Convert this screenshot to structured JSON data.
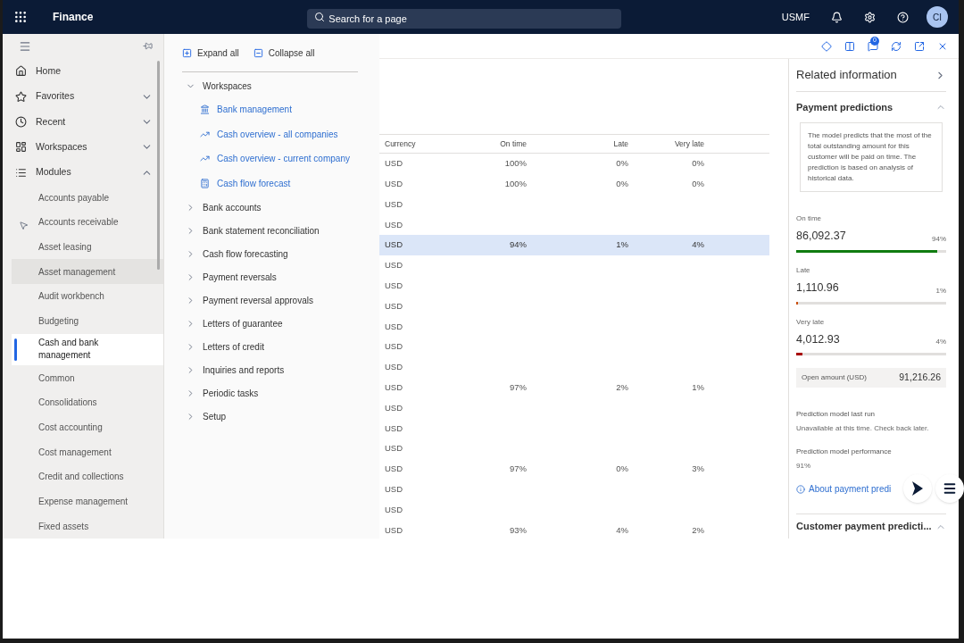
{
  "top_bar": {
    "app_name": "Finance",
    "search": {
      "placeholder": "Search for a page"
    },
    "company": "USMF",
    "avatar": "CI"
  },
  "nav": {
    "items": [
      {
        "label": "Home",
        "kind": "home"
      },
      {
        "label": "Favorites",
        "kind": "star",
        "expanded": false
      },
      {
        "label": "Recent",
        "kind": "clock",
        "expanded": false
      },
      {
        "label": "Workspaces",
        "kind": "workspace",
        "expanded": false
      },
      {
        "label": "Modules",
        "kind": "list",
        "expanded": true
      }
    ],
    "modules": [
      {
        "label": "Accounts payable",
        "selected": false,
        "hovered": false
      },
      {
        "label": "Accounts receivable",
        "selected": false,
        "hovered": false
      },
      {
        "label": "Asset leasing",
        "selected": false,
        "hovered": false
      },
      {
        "label": "Asset management",
        "selected": false,
        "hovered": true
      },
      {
        "label": "Audit workbench",
        "selected": false,
        "hovered": false
      },
      {
        "label": "Budgeting",
        "selected": false,
        "hovered": false
      },
      {
        "label": "Cash and bank management",
        "selected": true,
        "hovered": false
      },
      {
        "label": "Common",
        "selected": false,
        "hovered": false
      },
      {
        "label": "Consolidations",
        "selected": false,
        "hovered": false
      },
      {
        "label": "Cost accounting",
        "selected": false,
        "hovered": false
      },
      {
        "label": "Cost management",
        "selected": false,
        "hovered": false
      },
      {
        "label": "Credit and collections",
        "selected": false,
        "hovered": false
      },
      {
        "label": "Expense management",
        "selected": false,
        "hovered": false
      },
      {
        "label": "Fixed assets",
        "selected": false,
        "hovered": false
      }
    ]
  },
  "flyout": {
    "expand_all": "Expand all",
    "collapse_all": "Collapse all",
    "groups": [
      {
        "label": "Workspaces",
        "expanded": true,
        "children": [
          {
            "label": "Bank management",
            "kind": "bank"
          },
          {
            "label": "Cash overview - all companies",
            "kind": "trend"
          },
          {
            "label": "Cash overview - current company",
            "kind": "trend"
          },
          {
            "label": "Cash flow forecast",
            "kind": "forecast"
          }
        ]
      },
      {
        "label": "Bank accounts",
        "expanded": false
      },
      {
        "label": "Bank statement reconciliation",
        "expanded": false
      },
      {
        "label": "Cash flow forecasting",
        "expanded": false
      },
      {
        "label": "Payment reversals",
        "expanded": false
      },
      {
        "label": "Payment reversal approvals",
        "expanded": false
      },
      {
        "label": "Letters of guarantee",
        "expanded": false
      },
      {
        "label": "Letters of credit",
        "expanded": false
      },
      {
        "label": "Inquiries and reports",
        "expanded": false
      },
      {
        "label": "Periodic tasks",
        "expanded": false
      },
      {
        "label": "Setup",
        "expanded": false
      }
    ]
  },
  "toolbar": {
    "badge": "0"
  },
  "table": {
    "columns": [
      "Currency",
      "On time",
      "Late",
      "Very late"
    ],
    "rows": [
      {
        "cells": [
          "USD",
          "100%",
          "0%",
          "0%"
        ],
        "selected": false
      },
      {
        "cells": [
          "USD",
          "100%",
          "0%",
          "0%"
        ],
        "selected": false
      },
      {
        "cells": [
          "USD",
          "",
          "",
          ""
        ],
        "selected": false
      },
      {
        "cells": [
          "USD",
          "",
          "",
          ""
        ],
        "selected": false
      },
      {
        "cells": [
          "USD",
          "94%",
          "1%",
          "4%"
        ],
        "selected": true
      },
      {
        "cells": [
          "USD",
          "",
          "",
          ""
        ],
        "selected": false
      },
      {
        "cells": [
          "USD",
          "",
          "",
          ""
        ],
        "selected": false
      },
      {
        "cells": [
          "USD",
          "",
          "",
          ""
        ],
        "selected": false
      },
      {
        "cells": [
          "USD",
          "",
          "",
          ""
        ],
        "selected": false
      },
      {
        "cells": [
          "USD",
          "",
          "",
          ""
        ],
        "selected": false
      },
      {
        "cells": [
          "USD",
          "",
          "",
          ""
        ],
        "selected": false
      },
      {
        "cells": [
          "USD",
          "97%",
          "2%",
          "1%"
        ],
        "selected": false
      },
      {
        "cells": [
          "USD",
          "",
          "",
          ""
        ],
        "selected": false
      },
      {
        "cells": [
          "USD",
          "",
          "",
          ""
        ],
        "selected": false
      },
      {
        "cells": [
          "USD",
          "",
          "",
          ""
        ],
        "selected": false
      },
      {
        "cells": [
          "USD",
          "97%",
          "0%",
          "3%"
        ],
        "selected": false
      },
      {
        "cells": [
          "USD",
          "",
          "",
          ""
        ],
        "selected": false
      },
      {
        "cells": [
          "USD",
          "",
          "",
          ""
        ],
        "selected": false
      },
      {
        "cells": [
          "USD",
          "93%",
          "4%",
          "2%"
        ],
        "selected": false
      }
    ]
  },
  "related": {
    "title": "Related information",
    "payment_predictions": {
      "title": "Payment predictions",
      "expanded": true,
      "description": "The model predicts that the most of the total outstanding amount for this customer will be paid on time. The prediction is based on analysis of historical data.",
      "metrics": [
        {
          "label": "On time",
          "amount": "86,092.37",
          "percent": "94%",
          "level": 0.94,
          "color": "#107c10"
        },
        {
          "label": "Late",
          "amount": "1,110.96",
          "percent": "1%",
          "level": 0.01,
          "color": "#ca5010"
        },
        {
          "label": "Very late",
          "amount": "4,012.93",
          "percent": "4%",
          "level": 0.04,
          "color": "#a80000"
        }
      ],
      "open_amount_label": "Open amount (USD)",
      "open_amount": "91,216.26",
      "last_run_label": "Prediction model last run",
      "last_run": "Unavailable at this time. Check back later.",
      "performance_label": "Prediction model performance",
      "performance": "91%",
      "about_link": "About payment predi"
    },
    "customer_section": {
      "title": "Customer payment predicti...",
      "expanded": true
    }
  }
}
